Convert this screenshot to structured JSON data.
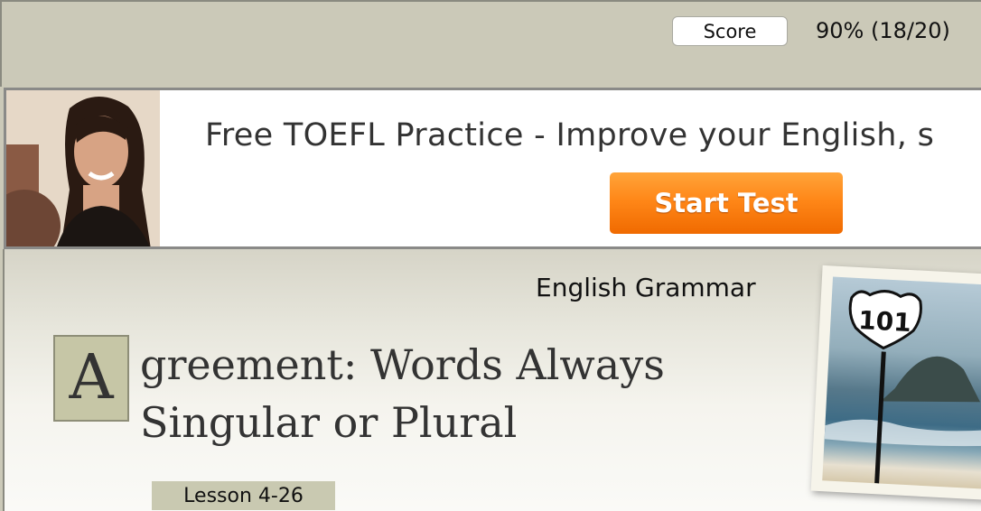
{
  "score": {
    "button_label": "Score",
    "value": "90% (18/20)"
  },
  "ad": {
    "headline": "Free TOEFL Practice - Improve your English, s",
    "cta_label": "Start Test"
  },
  "lesson": {
    "category": "English Grammar",
    "title_dropcap": "A",
    "title_line1": "greement: Words Always",
    "title_line2": "Singular or Plural",
    "lesson_label": "Lesson 4-26"
  },
  "photo": {
    "sign_text": "101"
  },
  "colors": {
    "page_bg": "#cbc9b8",
    "cta_orange": "#ff8718",
    "dropcap_bg": "#c6c6a6"
  }
}
